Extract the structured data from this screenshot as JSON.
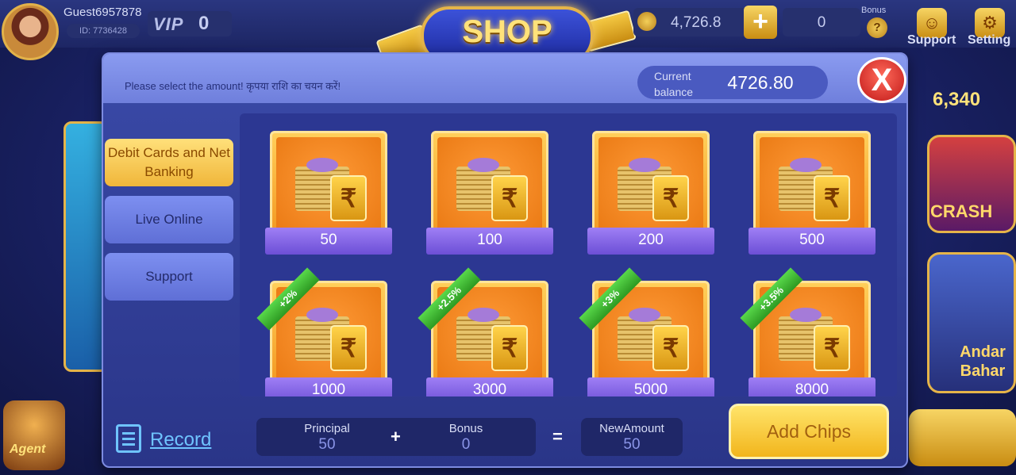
{
  "header": {
    "username": "Guest6957878",
    "user_id": "ID: 7736428",
    "vip_label": "VIP",
    "vip_level": "0",
    "shop_title": "SHOP",
    "coins": "4,726.8",
    "plus_label": "+",
    "bonus_amount": "0",
    "bonus_label": "Bonus",
    "support_label": "Support",
    "setting_label": "Setting"
  },
  "background": {
    "right_number": "6,340",
    "crash_label": "CRASH",
    "andar_label": "Andar Bahar",
    "agent_label": "Agent"
  },
  "modal": {
    "instruction": "Please select the amount! कृपया राशि का चयन करें!",
    "balance_label": "Current balance",
    "balance_value": "4726.80",
    "close_label": "X"
  },
  "tabs": [
    {
      "label": "Debit Cards and Net Banking",
      "active": true
    },
    {
      "label": "Live Online",
      "active": false
    },
    {
      "label": "Support",
      "active": false
    }
  ],
  "packages": [
    {
      "amount": "50",
      "bonus": ""
    },
    {
      "amount": "100",
      "bonus": ""
    },
    {
      "amount": "200",
      "bonus": ""
    },
    {
      "amount": "500",
      "bonus": ""
    },
    {
      "amount": "1000",
      "bonus": "+2%"
    },
    {
      "amount": "3000",
      "bonus": "+2.5%"
    },
    {
      "amount": "5000",
      "bonus": "+3%"
    },
    {
      "amount": "8000",
      "bonus": "+3.5%"
    }
  ],
  "rupee_symbol": "₹",
  "summary": {
    "record_label": "Record",
    "principal_label": "Principal",
    "principal_value": "50",
    "plus_op": "+",
    "bonus_label": "Bonus",
    "bonus_value": "0",
    "equals_op": "=",
    "new_amount_label": "NewAmount",
    "new_amount_value": "50",
    "add_chips_label": "Add Chips"
  },
  "colors": {
    "accent_gold": "#f2b51c",
    "tab_active": "#ffe07a",
    "package_band": "#6c4fd6",
    "ribbon_green": "#2d9a22",
    "close_red": "#c01818"
  }
}
